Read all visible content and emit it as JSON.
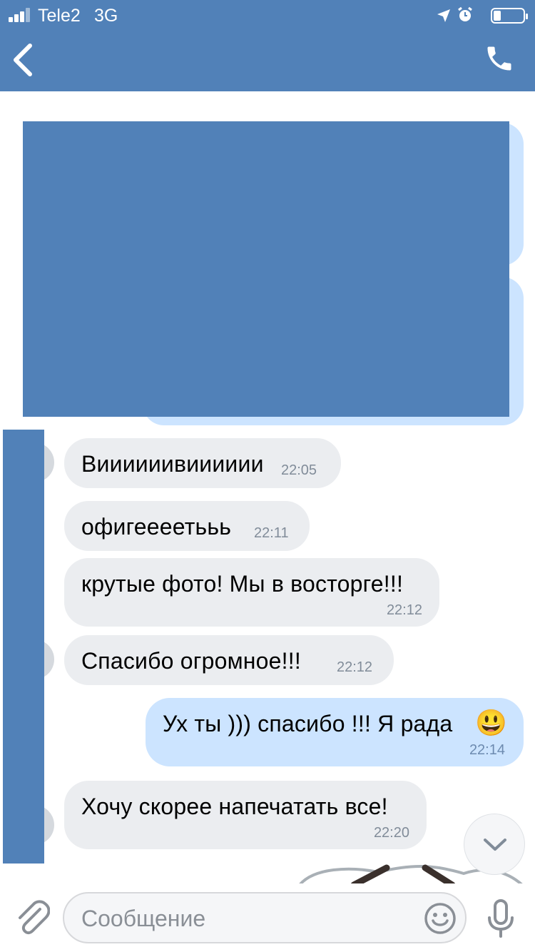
{
  "status_bar": {
    "carrier": "Tele2",
    "network": "3G"
  },
  "messages": [
    {
      "text": "Виииииивииииии",
      "time": "22:05",
      "direction": "incoming"
    },
    {
      "text": "офигеееетььь",
      "time": "22:11",
      "direction": "incoming"
    },
    {
      "text": "крутые фото! Мы в восторге!!!",
      "time": "22:12",
      "direction": "incoming"
    },
    {
      "text": "Спасибо огромное!!!",
      "time": "22:12",
      "direction": "incoming"
    },
    {
      "text": "Ух ты ))) спасибо !!! Я рада",
      "emoji": "😃",
      "time": "22:14",
      "direction": "outgoing"
    },
    {
      "text": "Хочу скорее напечатать все!",
      "time": "22:20",
      "direction": "incoming"
    }
  ],
  "composer": {
    "placeholder": "Сообщение"
  },
  "icons": {
    "back": "chevron-left-icon",
    "call": "phone-icon",
    "attach": "paperclip-icon",
    "emoji": "smiley-icon",
    "mic": "microphone-icon",
    "scroll": "chevron-down-icon"
  },
  "colors": {
    "header": "#5181b8",
    "incoming_bubble": "#ebedf0",
    "outgoing_bubble": "#cce4ff",
    "timestamp": "#818c99"
  }
}
